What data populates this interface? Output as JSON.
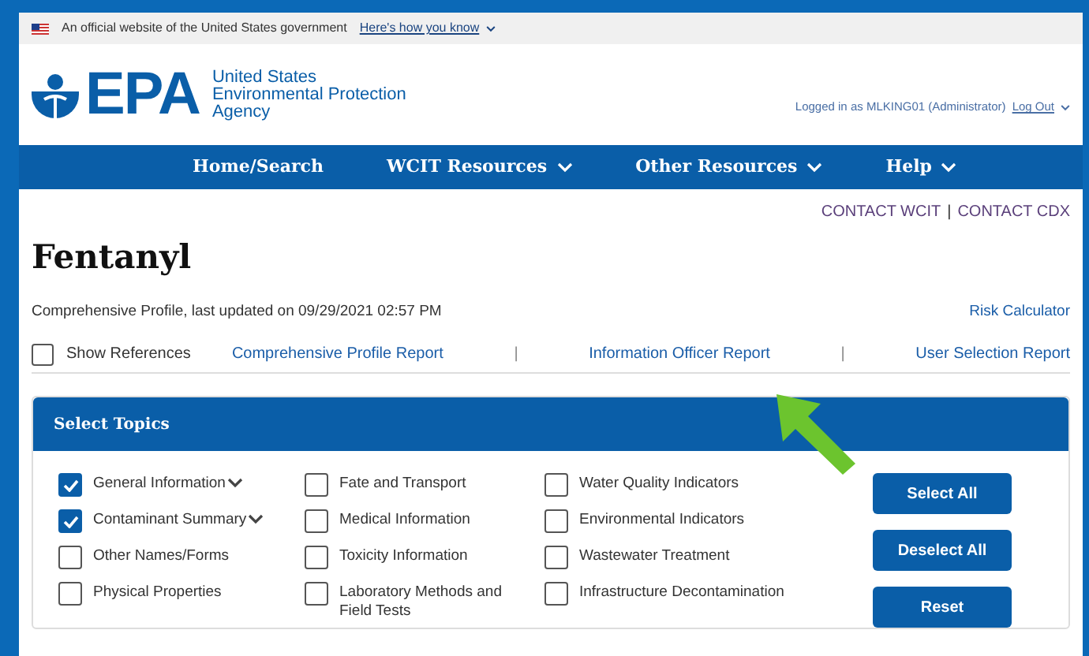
{
  "gov_banner": {
    "text": "An official website of the United States government",
    "link": "Here's how you know"
  },
  "header": {
    "logo_text": "EPA",
    "agency_name": [
      "United States",
      "Environmental Protection",
      "Agency"
    ],
    "login_text": "Logged in as MLKING01 (Administrator)",
    "logout": "Log Out"
  },
  "nav": [
    {
      "label": "Home/Search",
      "dropdown": false
    },
    {
      "label": "WCIT Resources",
      "dropdown": true
    },
    {
      "label": "Other Resources",
      "dropdown": true
    },
    {
      "label": "Help",
      "dropdown": true
    }
  ],
  "contact_links": [
    {
      "kind": "link",
      "text": "CONTACT WCIT"
    },
    {
      "kind": "separator",
      "text": "|"
    },
    {
      "kind": "link",
      "text": "CONTACT CDX"
    }
  ],
  "title": "Fentanyl",
  "subtitle": "Comprehensive Profile, last updated on 09/29/2021 02:57 PM",
  "risk_link": "Risk Calculator",
  "show_references": {
    "label": "Show References",
    "checked": false
  },
  "report_links": [
    {
      "kind": "link",
      "text": "Comprehensive Profile Report"
    },
    {
      "kind": "separator",
      "text": "|"
    },
    {
      "kind": "link",
      "text": "Information Officer Report"
    },
    {
      "kind": "separator",
      "text": "|"
    },
    {
      "kind": "link",
      "text": "User Selection Report"
    }
  ],
  "topics": {
    "title": "Select Topics",
    "columns": [
      [
        {
          "label": "General Information",
          "checked": true,
          "expandable": true
        },
        {
          "label": "Contaminant Summary",
          "checked": true,
          "expandable": true
        },
        {
          "label": "Other Names/Forms",
          "checked": false,
          "expandable": false
        },
        {
          "label": "Physical Properties",
          "checked": false,
          "expandable": false
        }
      ],
      [
        {
          "label": "Fate and Transport",
          "checked": false,
          "expandable": false
        },
        {
          "label": "Medical Information",
          "checked": false,
          "expandable": false
        },
        {
          "label": "Toxicity Information",
          "checked": false,
          "expandable": false
        },
        {
          "label": "Laboratory Methods and Field Tests",
          "checked": false,
          "expandable": false
        }
      ],
      [
        {
          "label": "Water Quality Indicators",
          "checked": false,
          "expandable": false
        },
        {
          "label": "Environmental Indicators",
          "checked": false,
          "expandable": false
        },
        {
          "label": "Wastewater Treatment",
          "checked": false,
          "expandable": false
        },
        {
          "label": "Infrastructure Decontamination",
          "checked": false,
          "expandable": false
        }
      ]
    ],
    "buttons": [
      "Select All",
      "Deselect All",
      "Reset"
    ]
  }
}
